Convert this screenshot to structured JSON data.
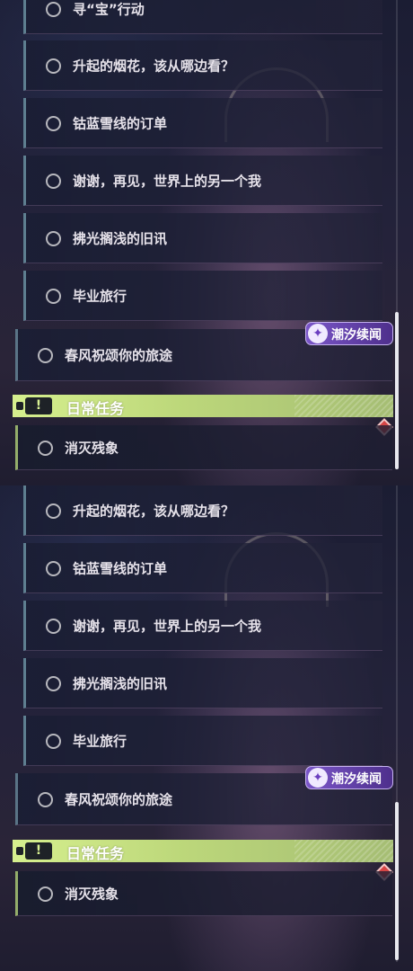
{
  "quests_first": [
    {
      "label": "寻“宝”行动"
    },
    {
      "label": "升起的烟花，该从哪边看？"
    },
    {
      "label": "钴蓝雪线的订单"
    },
    {
      "label": "谢谢，再见，世界上的另一个我"
    },
    {
      "label": "拂光搁浅的旧讯"
    },
    {
      "label": "毕业旅行"
    }
  ],
  "quests_second": [
    {
      "label": "升起的烟花，该从哪边看？"
    },
    {
      "label": "钴蓝雪线的订单"
    },
    {
      "label": "谢谢，再见，世界上的另一个我"
    },
    {
      "label": "拂光搁浅的旧讯"
    },
    {
      "label": "毕业旅行"
    }
  ],
  "main_quest": {
    "label": "春风祝颂你的旅途",
    "badge_label": "潮汐续闻",
    "badge_icon": "sparkle-icon"
  },
  "daily": {
    "header_label": "日常任务",
    "header_icon": "!",
    "quest_label": "消灭残象"
  },
  "colors": {
    "daily_accent": "#c9e486",
    "badge": "#6a46b8",
    "alert": "#d64545"
  }
}
